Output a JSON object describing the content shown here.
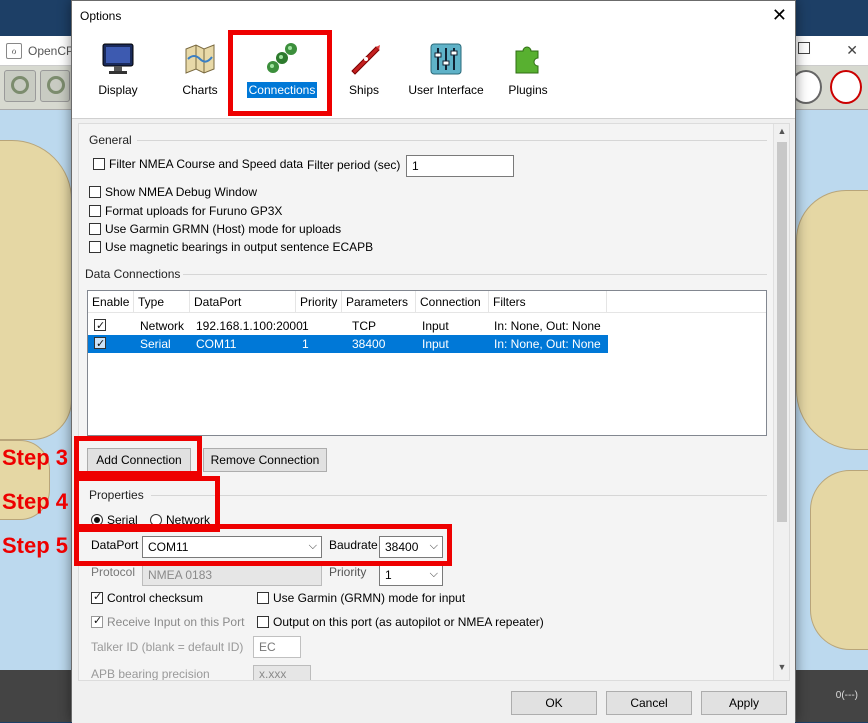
{
  "background_app": {
    "title": "OpenCP",
    "status_text": "0(---)"
  },
  "dialog": {
    "title": "Options",
    "close_label": "✕",
    "tabs": [
      {
        "label": "Display",
        "icon": "monitor-icon"
      },
      {
        "label": "Charts",
        "icon": "charts-icon"
      },
      {
        "label": "Connections",
        "icon": "connections-icon"
      },
      {
        "label": "Ships",
        "icon": "ship-icon"
      },
      {
        "label": "User Interface",
        "icon": "sliders-icon"
      },
      {
        "label": "Plugins",
        "icon": "puzzle-icon"
      }
    ],
    "active_tab": "Connections"
  },
  "general": {
    "heading": "General",
    "filter_nmea": {
      "label": "Filter NMEA Course and Speed data",
      "checked": false
    },
    "filter_period_label": "Filter period (sec)",
    "filter_period_value": "1",
    "show_debug": {
      "label": "Show NMEA Debug Window",
      "checked": false
    },
    "furuno": {
      "label": "Format uploads for Furuno GP3X",
      "checked": false
    },
    "garmin_host": {
      "label": "Use Garmin GRMN (Host) mode for uploads",
      "checked": false
    },
    "magnetic": {
      "label": "Use magnetic bearings in output sentence ECAPB",
      "checked": false
    }
  },
  "data_connections": {
    "heading": "Data Connections",
    "columns": [
      "Enable",
      "Type",
      "DataPort",
      "Priority",
      "Parameters",
      "Connection",
      "Filters"
    ],
    "rows": [
      {
        "enabled": true,
        "type": "Network",
        "dataport": "192.168.1.100:2000",
        "priority": "1",
        "parameters": "TCP",
        "connection": "Input",
        "filters": "In: None, Out: None",
        "selected": false
      },
      {
        "enabled": true,
        "type": "Serial",
        "dataport": "COM11",
        "priority": "1",
        "parameters": "38400",
        "connection": "Input",
        "filters": "In: None, Out: None",
        "selected": true
      }
    ],
    "add_button": "Add Connection",
    "remove_button": "Remove Connection"
  },
  "properties": {
    "heading": "Properties",
    "serial_label": "Serial",
    "network_label": "Network",
    "serial_selected": true,
    "dataport_label": "DataPort",
    "dataport_value": "COM11",
    "baudrate_label": "Baudrate",
    "baudrate_value": "38400",
    "protocol_label": "Protocol",
    "protocol_value": "NMEA 0183",
    "priority_label": "Priority",
    "priority_value": "1",
    "control_checksum": {
      "label": "Control checksum",
      "checked": true
    },
    "garmin_input": {
      "label": "Use Garmin (GRMN) mode for input",
      "checked": false
    },
    "receive_input": {
      "label": "Receive Input on this Port",
      "checked": true
    },
    "output_port": {
      "label": "Output on this port (as autopilot or NMEA repeater)",
      "checked": false
    },
    "talker_label": "Talker ID (blank = default ID)",
    "talker_value": "EC",
    "apb_label": "APB bearing precision",
    "apb_value": "x.xxx"
  },
  "buttons": {
    "ok": "OK",
    "cancel": "Cancel",
    "apply": "Apply"
  },
  "annotations": {
    "step3": "Step 3",
    "step4": "Step 4",
    "step5": "Step 5"
  },
  "colors": {
    "annotation_red": "#ee0000",
    "selection_blue": "#0078d7",
    "land": "#e5d7a4",
    "water": "#bcd9ee"
  }
}
